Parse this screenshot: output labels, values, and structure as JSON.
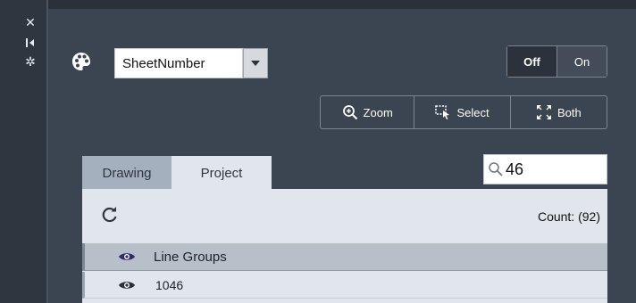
{
  "toolbar": {
    "property_combo": {
      "value": "SheetNumber"
    },
    "toggle": {
      "off_label": "Off",
      "on_label": "On",
      "active": "Off"
    },
    "view_modes": [
      {
        "label": "Zoom",
        "icon": "zoom-in-icon"
      },
      {
        "label": "Select",
        "icon": "select-window-icon"
      },
      {
        "label": "Both",
        "icon": "expand-arrows-icon"
      }
    ]
  },
  "tabs": [
    {
      "label": "Drawing",
      "selected": false
    },
    {
      "label": "Project",
      "selected": true
    }
  ],
  "search": {
    "value": "46"
  },
  "list": {
    "count_text": "Count: (92)",
    "header": {
      "label": "Line Groups",
      "icon": "eye-icon"
    },
    "items": [
      {
        "label": "1046",
        "icon": "eye-icon"
      }
    ]
  },
  "colors": {
    "panel_bg": "#3b4451",
    "tab_inactive": "#a4b0bd",
    "tab_active": "#e1e6ec",
    "header_eye": "#2f2a6e"
  }
}
